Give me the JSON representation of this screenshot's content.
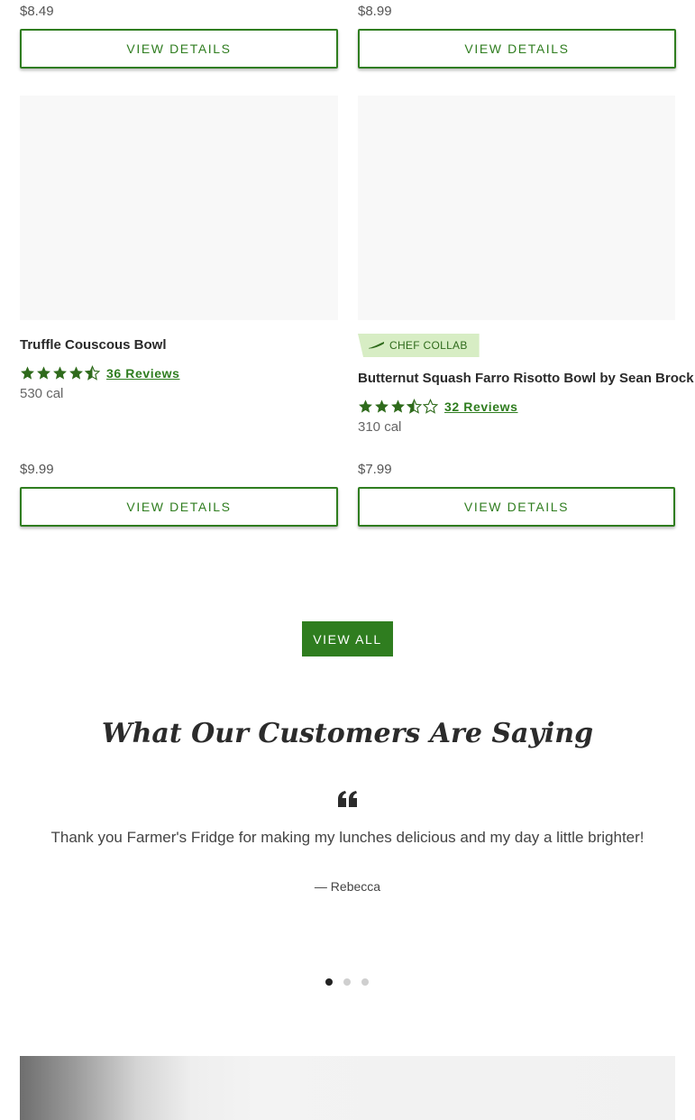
{
  "colors": {
    "accent": "#2f7d1f",
    "badge_bg": "#d7edc4",
    "star": "#2f6b1c"
  },
  "top_row": [
    {
      "price": "$8.49",
      "button": "VIEW DETAILS"
    },
    {
      "price": "$8.99",
      "button": "VIEW DETAILS"
    }
  ],
  "products": [
    {
      "name": "Truffle Couscous Bowl",
      "rating": 4.5,
      "reviews": "36 Reviews",
      "calories": "530 cal",
      "price": "$9.99",
      "button": "VIEW DETAILS"
    },
    {
      "badge": "CHEF COLLAB",
      "badge_icon": "knife-icon",
      "name": "Butternut Squash Farro Risotto Bowl by Sean Brock",
      "rating": 3.5,
      "reviews": "32 Reviews",
      "calories": "310 cal",
      "price": "$7.99",
      "button": "VIEW DETAILS"
    }
  ],
  "view_all": "VIEW ALL",
  "testimonials": {
    "heading": "What Our Customers Are Saying",
    "quote_icon": "quote-icon",
    "quote": "Thank you Farmer's Fridge for making my lunches delicious and my day a little brighter!",
    "author": "— Rebecca",
    "slide_count": 3,
    "active_slide": 1
  }
}
